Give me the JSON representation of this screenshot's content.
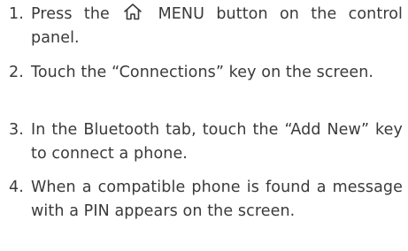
{
  "steps": [
    {
      "number": "1.",
      "text_before_icon": "Press the",
      "icon": "home-icon",
      "text_after_icon": "MENU button on the control panel."
    },
    {
      "number": "2.",
      "text": "Touch the “Connections” key on the screen."
    },
    {
      "number": "3.",
      "text": "In the Bluetooth tab, touch the “Add New” key to connect a phone."
    },
    {
      "number": "4.",
      "text": "When a compatible phone is found a message with a PIN appears on the screen."
    }
  ]
}
